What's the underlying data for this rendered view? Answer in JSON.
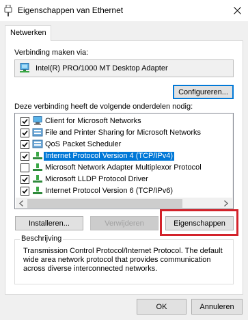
{
  "window": {
    "title": "Eigenschappen van Ethernet",
    "icon": "network-adapter-icon"
  },
  "tabs": [
    {
      "label": "Netwerken",
      "active": true
    }
  ],
  "connect": {
    "label": "Verbinding maken via:",
    "adapter_name": "Intel(R) PRO/1000 MT Desktop Adapter",
    "configure_button": "Configureren..."
  },
  "components": {
    "label": "Deze verbinding heeft de volgende onderdelen nodig:",
    "items": [
      {
        "label": "Client for Microsoft Networks",
        "checked": true,
        "icon": "network-client-icon",
        "selected": false
      },
      {
        "label": "File and Printer Sharing for Microsoft Networks",
        "checked": true,
        "icon": "network-service-icon",
        "selected": false
      },
      {
        "label": "QoS Packet Scheduler",
        "checked": true,
        "icon": "network-service-icon",
        "selected": false
      },
      {
        "label": "Internet Protocol Version 4 (TCP/IPv4)",
        "checked": true,
        "icon": "protocol-icon",
        "selected": true
      },
      {
        "label": "Microsoft Network Adapter Multiplexor Protocol",
        "checked": false,
        "icon": "protocol-icon",
        "selected": false
      },
      {
        "label": "Microsoft LLDP Protocol Driver",
        "checked": true,
        "icon": "protocol-icon",
        "selected": false
      },
      {
        "label": "Internet Protocol Version 6 (TCP/IPv6)",
        "checked": true,
        "icon": "protocol-icon",
        "selected": false
      }
    ]
  },
  "buttons": {
    "install": "Installeren...",
    "remove": "Verwijderen",
    "properties": "Eigenschappen",
    "ok": "OK",
    "cancel": "Annuleren"
  },
  "description": {
    "legend": "Beschrijving",
    "text": "Transmission Control Protocol/Internet Protocol. The default wide area network protocol that provides communication across diverse interconnected networks."
  },
  "colors": {
    "accent": "#0078d7",
    "highlight": "#d3222a"
  }
}
